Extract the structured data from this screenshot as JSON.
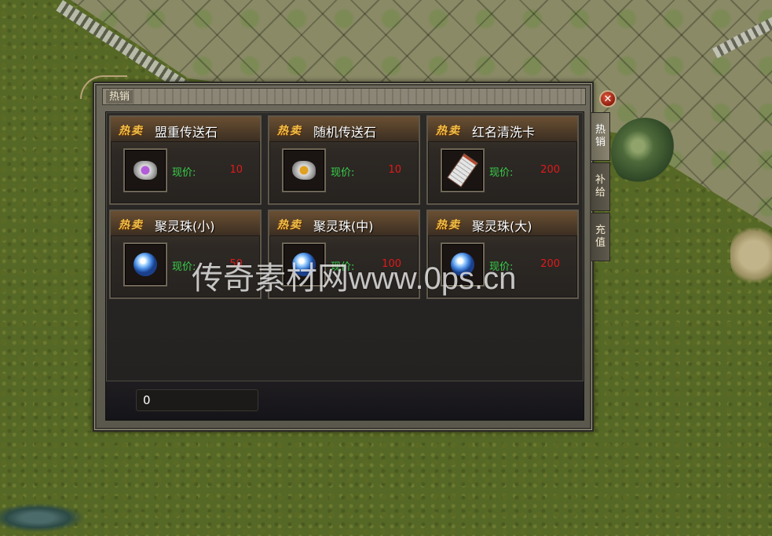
{
  "window": {
    "title": "热销",
    "close_symbol": "✕"
  },
  "items": [
    {
      "tag": "热卖",
      "name": "盟重传送石",
      "price_label": "现价:",
      "price": "10",
      "icon": "purple-stone-icon"
    },
    {
      "tag": "热卖",
      "name": "随机传送石",
      "price_label": "现价:",
      "price": "10",
      "icon": "gold-stone-icon"
    },
    {
      "tag": "热卖",
      "name": "红名清洗卡",
      "price_label": "现价:",
      "price": "200",
      "icon": "cleanse-card-icon"
    },
    {
      "tag": "热卖",
      "name": "聚灵珠(小)",
      "price_label": "现价:",
      "price": "50",
      "icon": "orb-icon"
    },
    {
      "tag": "热卖",
      "name": "聚灵珠(中)",
      "price_label": "现价:",
      "price": "100",
      "icon": "orb-icon"
    },
    {
      "tag": "热卖",
      "name": "聚灵珠(大)",
      "price_label": "现价:",
      "price": "200",
      "icon": "orb-icon"
    }
  ],
  "currency_field": {
    "value": "0"
  },
  "side_tabs": [
    {
      "label": "热销",
      "active": true
    },
    {
      "label": "补给",
      "active": false
    },
    {
      "label": "充值",
      "active": false
    }
  ],
  "watermark": "传奇素材网www.0ps.cn",
  "colors": {
    "price_label": "#37d14a",
    "price_value": "#e01a1a",
    "hot_tag": "#f0c04a"
  }
}
